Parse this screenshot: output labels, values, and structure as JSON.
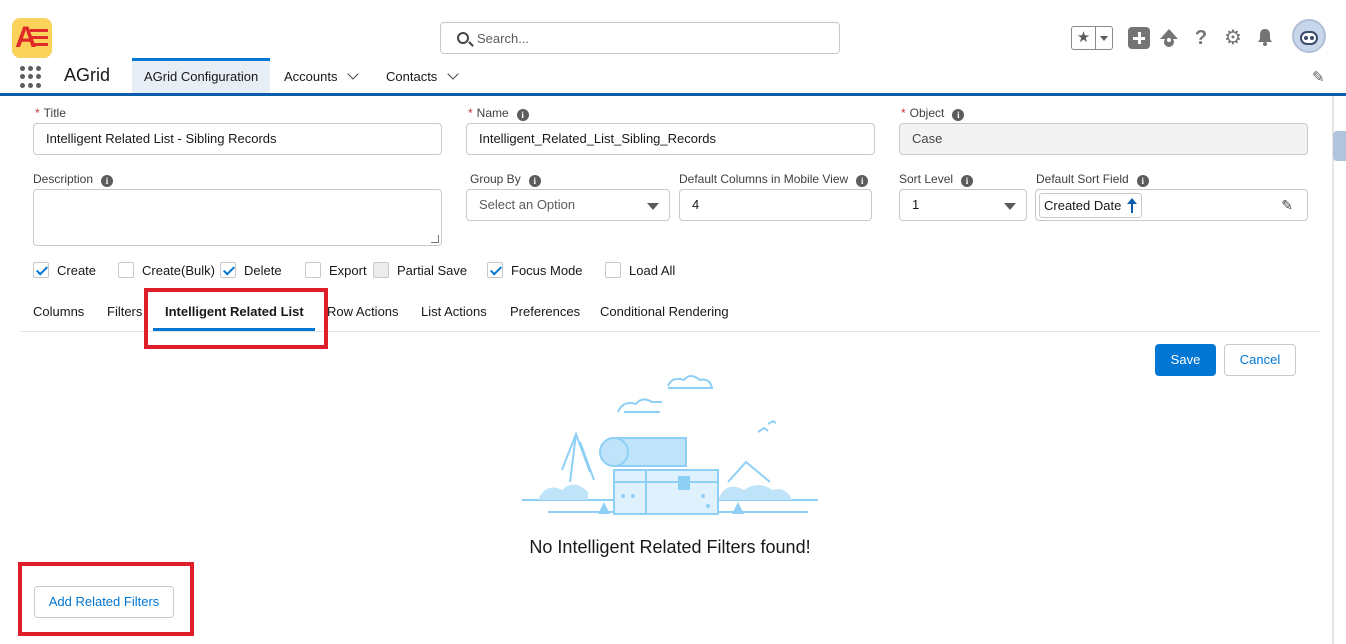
{
  "header": {
    "logo_letter": "A",
    "search_placeholder": "Search...",
    "icons": [
      "star-icon",
      "chevron-down-icon",
      "plus-icon",
      "trailhead-icon",
      "help-icon",
      "gear-icon",
      "bell-icon",
      "avatar"
    ]
  },
  "nav": {
    "app_name": "AGrid",
    "tabs": [
      {
        "label": "AGrid Configuration",
        "active": true
      },
      {
        "label": "Accounts",
        "has_menu": true
      },
      {
        "label": "Contacts",
        "has_menu": true
      }
    ]
  },
  "form": {
    "title_label": "Title",
    "title_value": "Intelligent Related List - Sibling Records",
    "name_label": "Name",
    "name_value": "Intelligent_Related_List_Sibling_Records",
    "object_label": "Object",
    "object_value": "Case",
    "description_label": "Description",
    "group_by_label": "Group By",
    "group_by_placeholder": "Select an Option",
    "mobile_cols_label": "Default Columns in Mobile View",
    "mobile_cols_value": "4",
    "sort_level_label": "Sort Level",
    "sort_level_value": "1",
    "sort_field_label": "Default Sort Field",
    "sort_field_value": "Created Date",
    "required_mark": "*",
    "info_glyph": "i"
  },
  "checkboxes": [
    {
      "label": "Create",
      "checked": true
    },
    {
      "label": "Create(Bulk)",
      "checked": false
    },
    {
      "label": "Delete",
      "checked": true
    },
    {
      "label": "Export",
      "checked": false
    },
    {
      "label": "Partial Save",
      "checked": false,
      "disabled": true
    },
    {
      "label": "Focus Mode",
      "checked": true
    },
    {
      "label": "Load All",
      "checked": false
    }
  ],
  "tabs": [
    {
      "label": "Columns"
    },
    {
      "label": "Filters"
    },
    {
      "label": "Intelligent Related List",
      "active": true
    },
    {
      "label": "Row Actions"
    },
    {
      "label": "List Actions"
    },
    {
      "label": "Preferences"
    },
    {
      "label": "Conditional Rendering"
    }
  ],
  "actions": {
    "save": "Save",
    "cancel": "Cancel",
    "add_related_filters": "Add Related Filters"
  },
  "empty_state": {
    "message": "No Intelligent Related Filters found!"
  },
  "colors": {
    "brand": "#0176d3",
    "highlight": "#e01e2b",
    "illustration": "#8ed0f5"
  }
}
